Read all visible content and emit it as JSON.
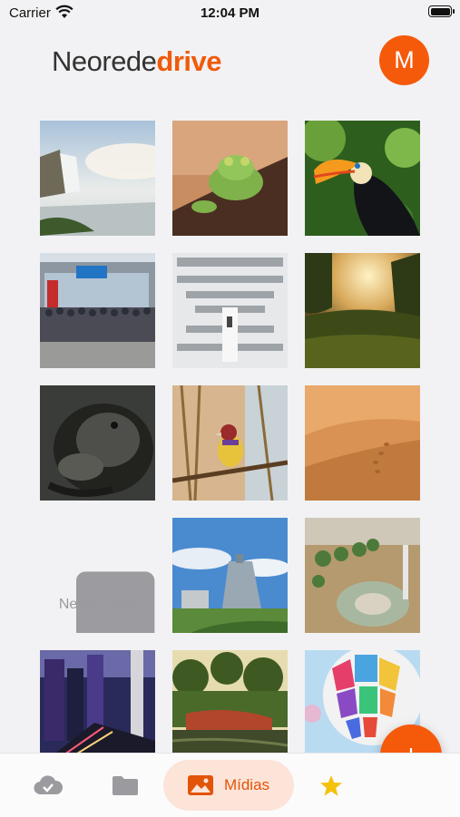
{
  "status_bar": {
    "carrier": "Carrier",
    "time": "12:04 PM"
  },
  "header": {
    "logo_part1": "Neorede",
    "logo_part2": "drive",
    "avatar_initial": "M"
  },
  "media": {
    "video_filename": "Nextc...mp4",
    "items": [
      {
        "type": "photo",
        "subject": "waterfall"
      },
      {
        "type": "photo",
        "subject": "frog"
      },
      {
        "type": "photo",
        "subject": "toucan"
      },
      {
        "type": "photo",
        "subject": "group-photo-building"
      },
      {
        "type": "photo",
        "subject": "library-interior"
      },
      {
        "type": "photo",
        "subject": "sunset-field"
      },
      {
        "type": "photo",
        "subject": "gorilla"
      },
      {
        "type": "photo",
        "subject": "finch-bird"
      },
      {
        "type": "photo",
        "subject": "desert-dunes"
      },
      {
        "type": "video",
        "subject": "video-file"
      },
      {
        "type": "photo",
        "subject": "modern-building"
      },
      {
        "type": "photo",
        "subject": "city-plaza-aerial"
      },
      {
        "type": "photo",
        "subject": "city-night-street"
      },
      {
        "type": "photo",
        "subject": "park-lake"
      },
      {
        "type": "photo",
        "subject": "hot-air-balloon"
      }
    ]
  },
  "fab": {
    "label": "+"
  },
  "tabbar": {
    "media_label": "Mídias",
    "icons": [
      "cloud-check-icon",
      "folder-icon",
      "image-icon",
      "star-icon"
    ],
    "active_color": "#f05a0a"
  },
  "colors": {
    "accent": "#f55a0a",
    "background": "#f2f2f4"
  }
}
